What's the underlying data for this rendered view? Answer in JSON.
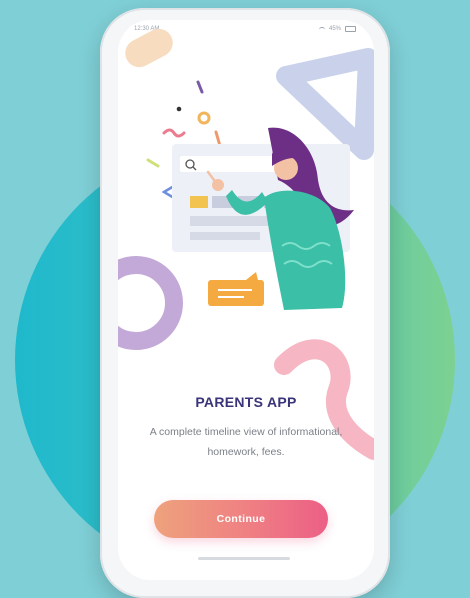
{
  "status_bar": {
    "time": "12:30 AM",
    "battery": "45%"
  },
  "onboarding": {
    "title": "PARENTS APP",
    "description": "A complete timeline view of informational, homework, fees.",
    "continue_label": "Continue"
  },
  "colors": {
    "background": "#7fcfd6",
    "title": "#3a3478",
    "button_start": "#eea27c",
    "button_end": "#ec5f86"
  }
}
